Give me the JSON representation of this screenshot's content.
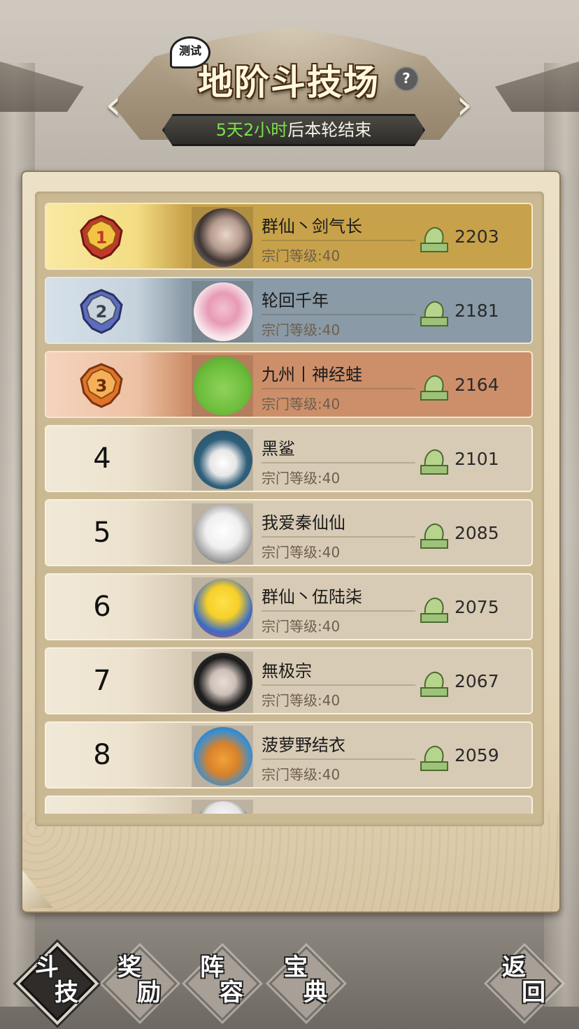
{
  "header": {
    "test_tag": "测试",
    "title": "地阶斗技场",
    "help_icon": "question-icon",
    "timer_highlight": "5天2小时",
    "timer_suffix": "后本轮结束",
    "prev_icon": "chevron-left-icon",
    "next_icon": "chevron-right-icon"
  },
  "colors": {
    "timer_highlight": "#7be04d",
    "rank1_row": "#c8a24a",
    "rank2_row": "#8a9aa6",
    "rank3_row": "#cd8f6a",
    "default_row": "#d8cbb5"
  },
  "leaderboard": {
    "rows": [
      {
        "rank": "1",
        "name": "群仙丶剑气长",
        "level": "宗门等级:40",
        "score": "2203",
        "avatar": "photo-avatar"
      },
      {
        "rank": "2",
        "name": "轮回千年",
        "level": "宗门等级:40",
        "score": "2181",
        "avatar": "couple-photo-avatar"
      },
      {
        "rank": "3",
        "name": "九州丨神经蛙",
        "level": "宗门等级:40",
        "score": "2164",
        "avatar": "frog-avatar"
      },
      {
        "rank": "4",
        "name": "黑鲨",
        "level": "宗门等级:40",
        "score": "2101",
        "avatar": "astronaut-avatar"
      },
      {
        "rank": "5",
        "name": "我爱秦仙仙",
        "level": "宗门等级:40",
        "score": "2085",
        "avatar": "anime-avatar"
      },
      {
        "rank": "6",
        "name": "群仙丶伍陆柒",
        "level": "宗门等级:40",
        "score": "2075",
        "avatar": "minion-avatar"
      },
      {
        "rank": "7",
        "name": "無极宗",
        "level": "宗门等级:40",
        "score": "2067",
        "avatar": "anime-dark-avatar"
      },
      {
        "rank": "8",
        "name": "菠萝野结衣",
        "level": "宗门等级:40",
        "score": "2059",
        "avatar": "pineapple-house-avatar"
      }
    ],
    "score_icon": "jade-seal-icon"
  },
  "nav": [
    {
      "c1": "斗",
      "c2": "技",
      "active": true
    },
    {
      "c1": "奖",
      "c2": "励",
      "active": false
    },
    {
      "c1": "阵",
      "c2": "容",
      "active": false
    },
    {
      "c1": "宝",
      "c2": "典",
      "active": false
    },
    {
      "c1": "返",
      "c2": "回",
      "active": false
    }
  ]
}
